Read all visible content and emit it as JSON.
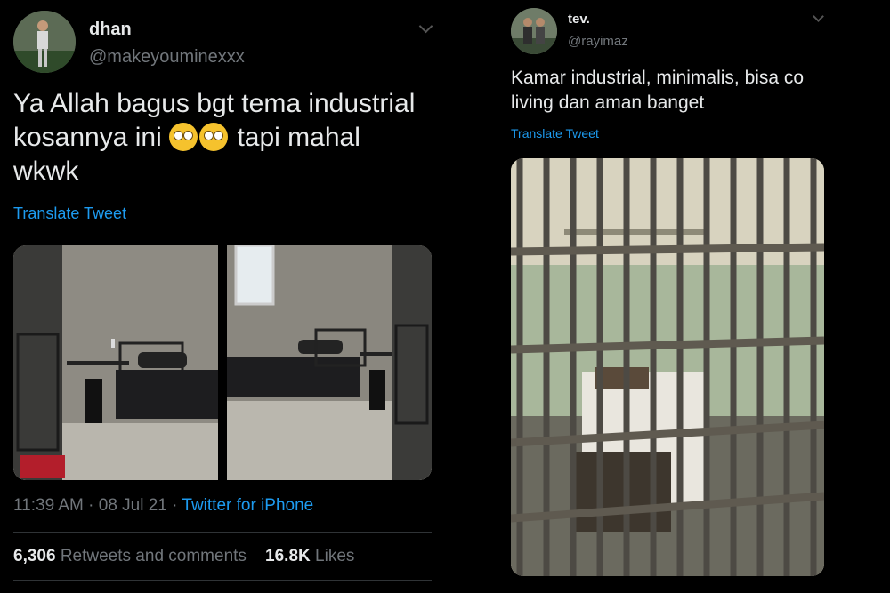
{
  "left_tweet": {
    "display_name": "dhan",
    "handle": "@makeyouminexxx",
    "text_part1": "Ya Allah bagus bgt tema industrial kosannya ini",
    "text_part2": "tapi mahal wkwk",
    "emojis": [
      "face-with-rolling-eyes-icon",
      "face-with-rolling-eyes-icon"
    ],
    "translate": "Translate Tweet",
    "time": "11:39 AM · 08 Jul 21 · ",
    "source": "Twitter for iPhone",
    "retweets_count": "6,306",
    "retweets_label": "Retweets and comments",
    "likes_count": "16.8K",
    "likes_label": "Likes"
  },
  "right_tweet": {
    "display_name": "tev.",
    "handle": "@rayimaz",
    "text": "Kamar industrial, minimalis, bisa co living dan aman banget",
    "translate": "Translate Tweet"
  },
  "colors": {
    "background": "#000000",
    "link": "#1d9bf0",
    "secondary_text": "#71767b",
    "primary_text": "#e7e9ea"
  }
}
